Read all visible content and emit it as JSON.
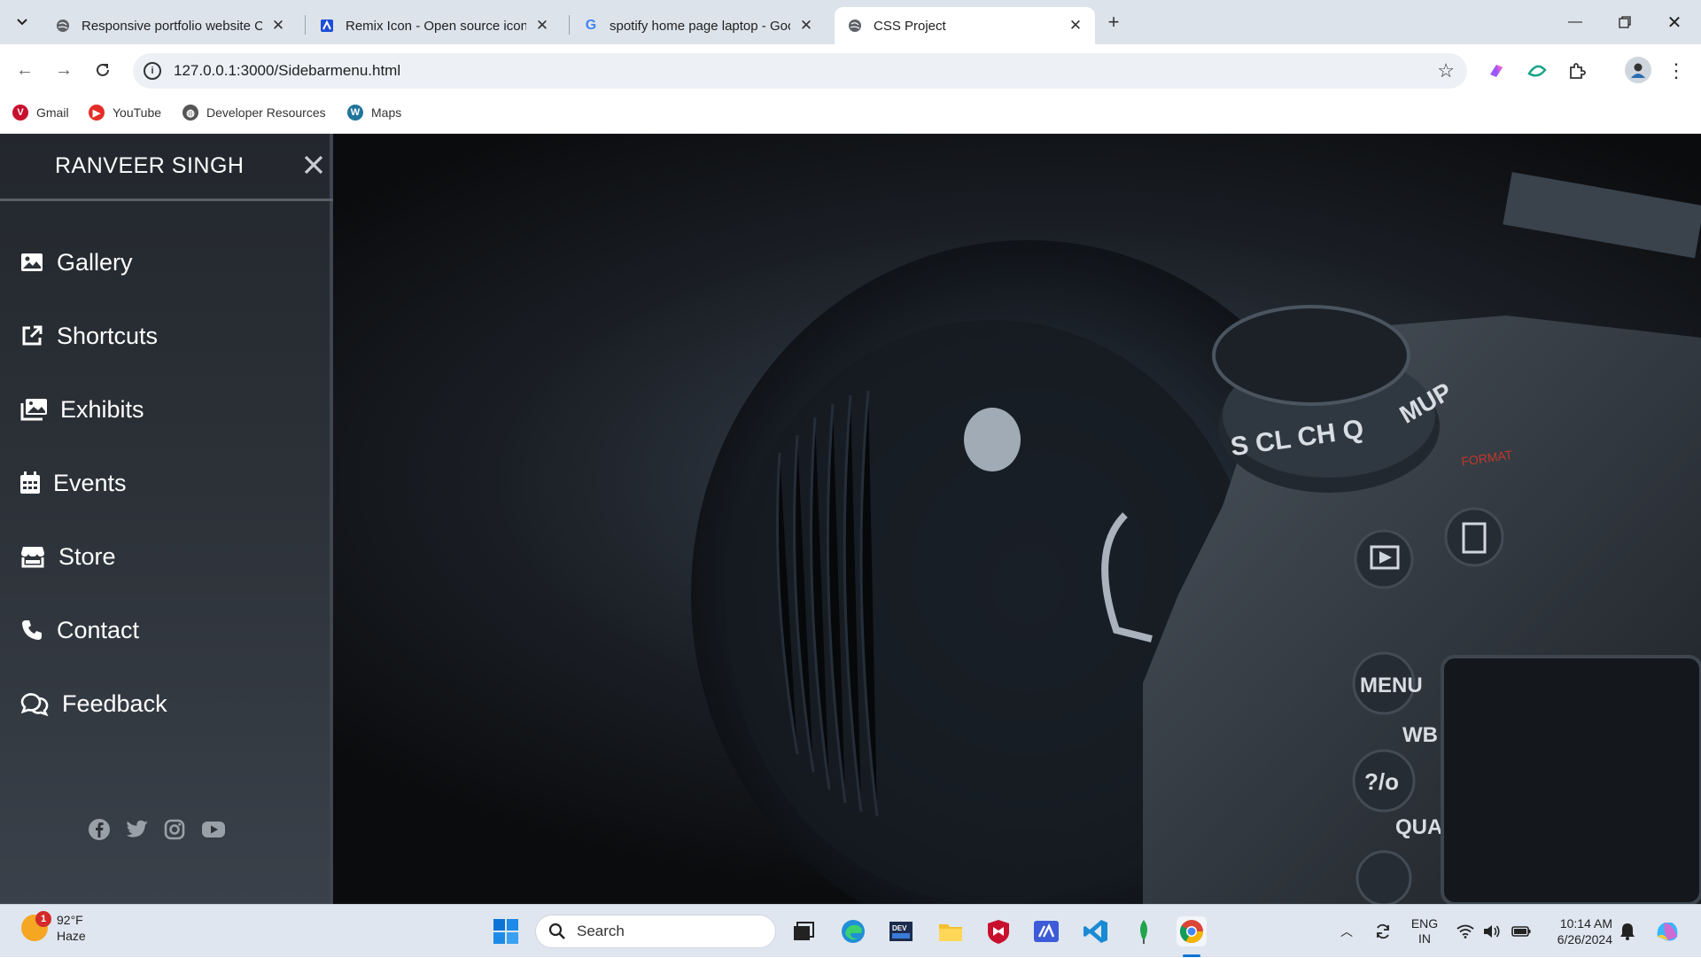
{
  "browser": {
    "tabs": [
      {
        "label": "Responsive portfolio website Cl",
        "favicon": "globe-icon"
      },
      {
        "label": "Remix Icon - Open source icon",
        "favicon": "remix-icon"
      },
      {
        "label": "spotify home page laptop - Goo",
        "favicon": "google-icon"
      },
      {
        "label": "CSS Project",
        "favicon": "globe-icon",
        "active": true
      }
    ],
    "url": "127.0.0.1:3000/Sidebarmenu.html",
    "bookmarks": [
      {
        "label": "Gmail",
        "icon": "vivaldi-icon",
        "color": "#c8102e"
      },
      {
        "label": "YouTube",
        "icon": "youtube-icon",
        "color": "#e52d27"
      },
      {
        "label": "Developer Resources",
        "icon": "globe-icon",
        "color": "#555555"
      },
      {
        "label": "Maps",
        "icon": "wordpress-icon",
        "color": "#21759b"
      }
    ]
  },
  "sidebar": {
    "title": "RANVEER SINGH",
    "items": [
      {
        "label": "Gallery",
        "icon": "image-icon"
      },
      {
        "label": "Shortcuts",
        "icon": "external-link-icon"
      },
      {
        "label": "Exhibits",
        "icon": "gallery-stack-icon"
      },
      {
        "label": "Events",
        "icon": "calendar-icon"
      },
      {
        "label": "Store",
        "icon": "store-icon"
      },
      {
        "label": "Contact",
        "icon": "phone-icon"
      },
      {
        "label": "Feedback",
        "icon": "chat-icon"
      }
    ],
    "social": [
      "facebook-icon",
      "twitter-icon",
      "instagram-icon",
      "youtube-icon"
    ]
  },
  "taskbar": {
    "weather": {
      "temp": "92°F",
      "condition": "Haze",
      "badge": "1"
    },
    "search_label": "Search",
    "lang": {
      "line1": "ENG",
      "line2": "IN"
    },
    "time": "10:14 AM",
    "date": "6/26/2024"
  },
  "colors": {
    "accent": "#1a73e8",
    "sidebar_bg": "#2c3138",
    "page_bg": "#0c0d0f"
  }
}
